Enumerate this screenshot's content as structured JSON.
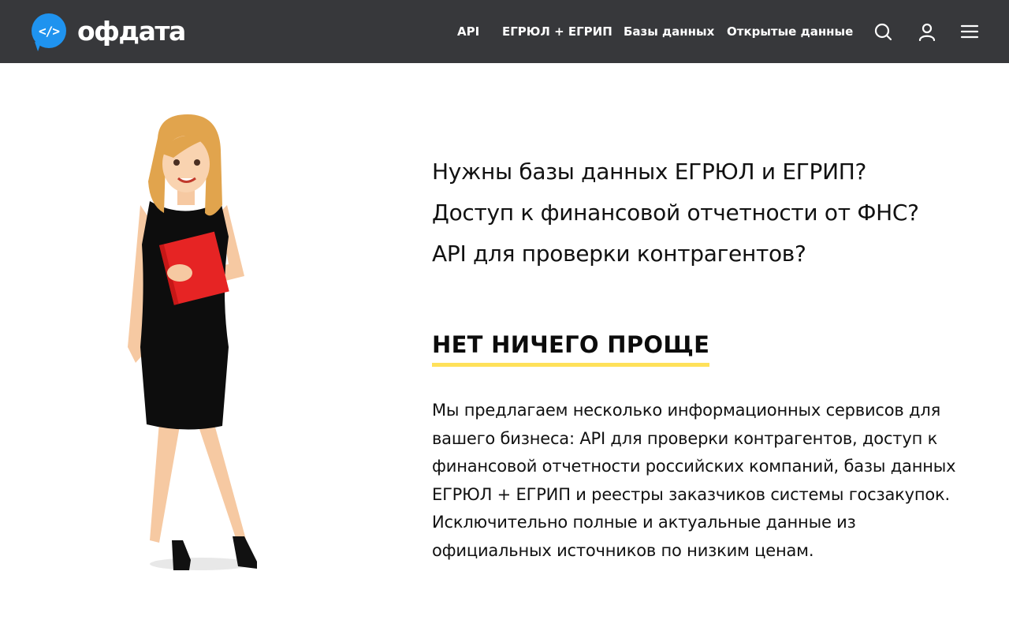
{
  "header": {
    "logo_text": "офдата",
    "logo_badge": "</>",
    "nav": [
      "API",
      "ЕГРЮЛ + ЕГРИП",
      "Базы данных",
      "Открытые данные"
    ],
    "icons": [
      "search-icon",
      "user-icon",
      "menu-icon"
    ]
  },
  "hero": {
    "questions": [
      "Нужны базы данных ЕГРЮЛ и ЕГРИП?",
      "Доступ к финансовой отчетности от ФНС?",
      "API для проверки контрагентов?"
    ],
    "heading": "НЕТ НИЧЕГО ПРОЩЕ",
    "description": "Мы предлагаем несколько информационных сервисов для вашего бизнеса: API для проверки контрагентов, доступ к финансовой отчетности российских компаний, базы данных ЕГРЮЛ + ЕГРИП и реестры заказчиков системы госзакупок. Исключительно полные и актуальные данные из официальных источников по низким ценам."
  },
  "colors": {
    "topbar": "#37383b",
    "brand": "#1f93ef",
    "underline": "#ffe15a",
    "folder": "#e62424"
  }
}
